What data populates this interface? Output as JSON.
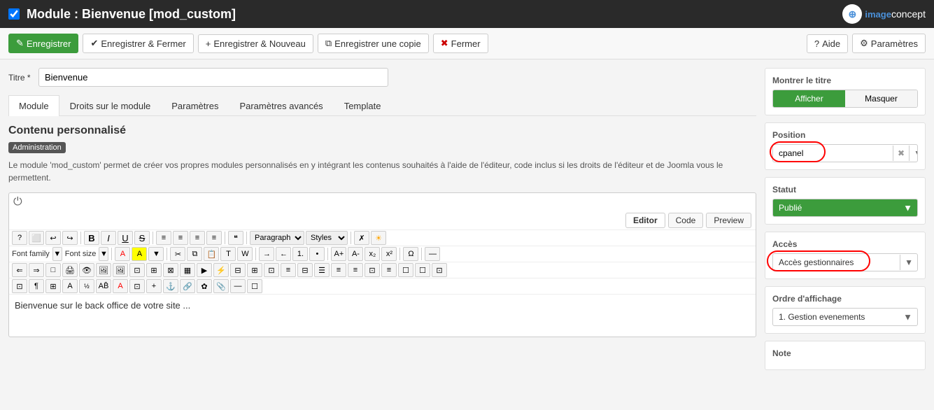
{
  "header": {
    "title": "Module : Bienvenue [mod_custom]",
    "logo_text": "image",
    "logo_accent": "concept"
  },
  "toolbar": {
    "save_label": "Enregistrer",
    "save_close_label": "Enregistrer & Fermer",
    "save_new_label": "Enregistrer & Nouveau",
    "save_copy_label": "Enregistrer une copie",
    "close_label": "Fermer",
    "help_label": "Aide",
    "params_label": "Paramètres"
  },
  "form": {
    "title_label": "Titre *",
    "title_value": "Bienvenue"
  },
  "tabs": [
    {
      "id": "module",
      "label": "Module",
      "active": true
    },
    {
      "id": "droits",
      "label": "Droits sur le module",
      "active": false
    },
    {
      "id": "parametres",
      "label": "Paramètres",
      "active": false
    },
    {
      "id": "parametres_avances",
      "label": "Paramètres avancés",
      "active": false
    },
    {
      "id": "template",
      "label": "Template",
      "active": false
    }
  ],
  "main": {
    "section_title": "Contenu personnalisé",
    "badge": "Administration",
    "description": "Le module 'mod_custom' permet de créer vos propres modules personnalisés en y intégrant les contenus souhaités à l'aide de l'éditeur, code inclus si les droits de l'éditeur et de Joomla vous le permettent.",
    "editor_tabs": [
      {
        "label": "Editor",
        "active": true
      },
      {
        "label": "Code",
        "active": false
      },
      {
        "label": "Preview",
        "active": false
      }
    ],
    "editor_content": "Bienvenue sur le back office de votre site ...",
    "toolbar_row1": [
      "help",
      "new",
      "undo",
      "redo",
      "bold",
      "italic",
      "underline",
      "strikethrough",
      "align-left",
      "align-center",
      "align-right",
      "align-justify",
      "blockquote",
      "paragraph",
      "styles",
      "eraser",
      "highlight"
    ],
    "font_family_label": "Font family",
    "font_size_label": "Font size"
  },
  "right": {
    "show_title_label": "Montrer le titre",
    "afficher_label": "Afficher",
    "masquer_label": "Masquer",
    "position_label": "Position",
    "position_value": "cpanel",
    "statut_label": "Statut",
    "statut_value": "Publié",
    "acces_label": "Accès",
    "acces_value": "Accès gestionnaires",
    "ordre_label": "Ordre d'affichage",
    "ordre_value": "1. Gestion evenements",
    "note_label": "Note"
  }
}
